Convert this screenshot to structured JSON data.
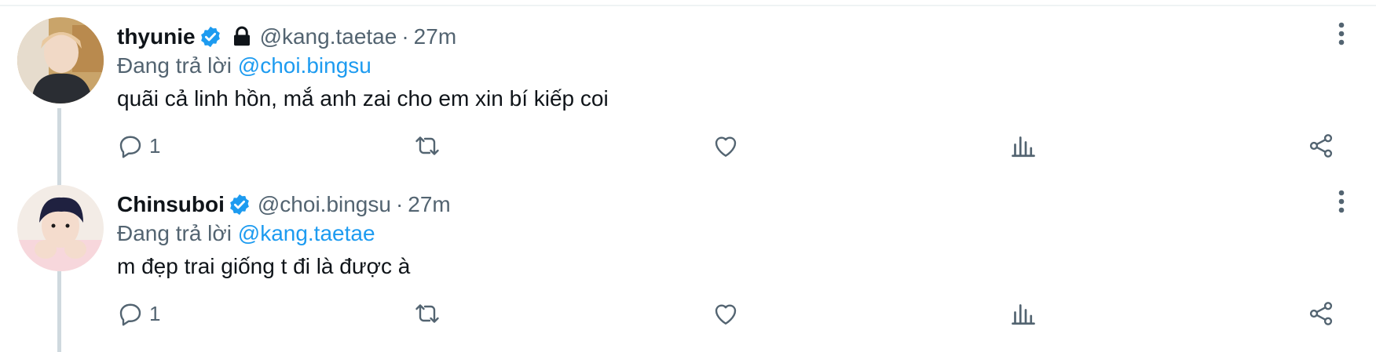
{
  "thread": [
    {
      "display_name": "thyunie",
      "verified": true,
      "locked": true,
      "handle": "@kang.taetae",
      "separator": "·",
      "time": "27m",
      "reply_prefix": "Đang trả lời",
      "reply_to": "@choi.bingsu",
      "text": "quãi cả linh hồn, mắ anh zai cho em xin bí kiếp coi",
      "reply_count": "1",
      "avatar_icon": "avatar-photo"
    },
    {
      "display_name": "Chinsuboi",
      "verified": true,
      "locked": false,
      "handle": "@choi.bingsu",
      "separator": "·",
      "time": "27m",
      "reply_prefix": "Đang trả lời",
      "reply_to": "@kang.taetae",
      "text": "m đẹp trai giống t đi là được à",
      "reply_count": "1",
      "avatar_icon": "avatar-photo"
    }
  ],
  "icons": {
    "verified": "verified-badge-icon",
    "lock": "lock-icon",
    "more": "more-vertical-icon",
    "reply": "reply-icon",
    "retweet": "retweet-icon",
    "like": "heart-icon",
    "views": "views-chart-icon",
    "share": "share-icon"
  },
  "colors": {
    "accent": "#1d9bf0",
    "secondary_text": "#536471",
    "primary_text": "#0f1419",
    "thread_line": "#cfd9de"
  }
}
